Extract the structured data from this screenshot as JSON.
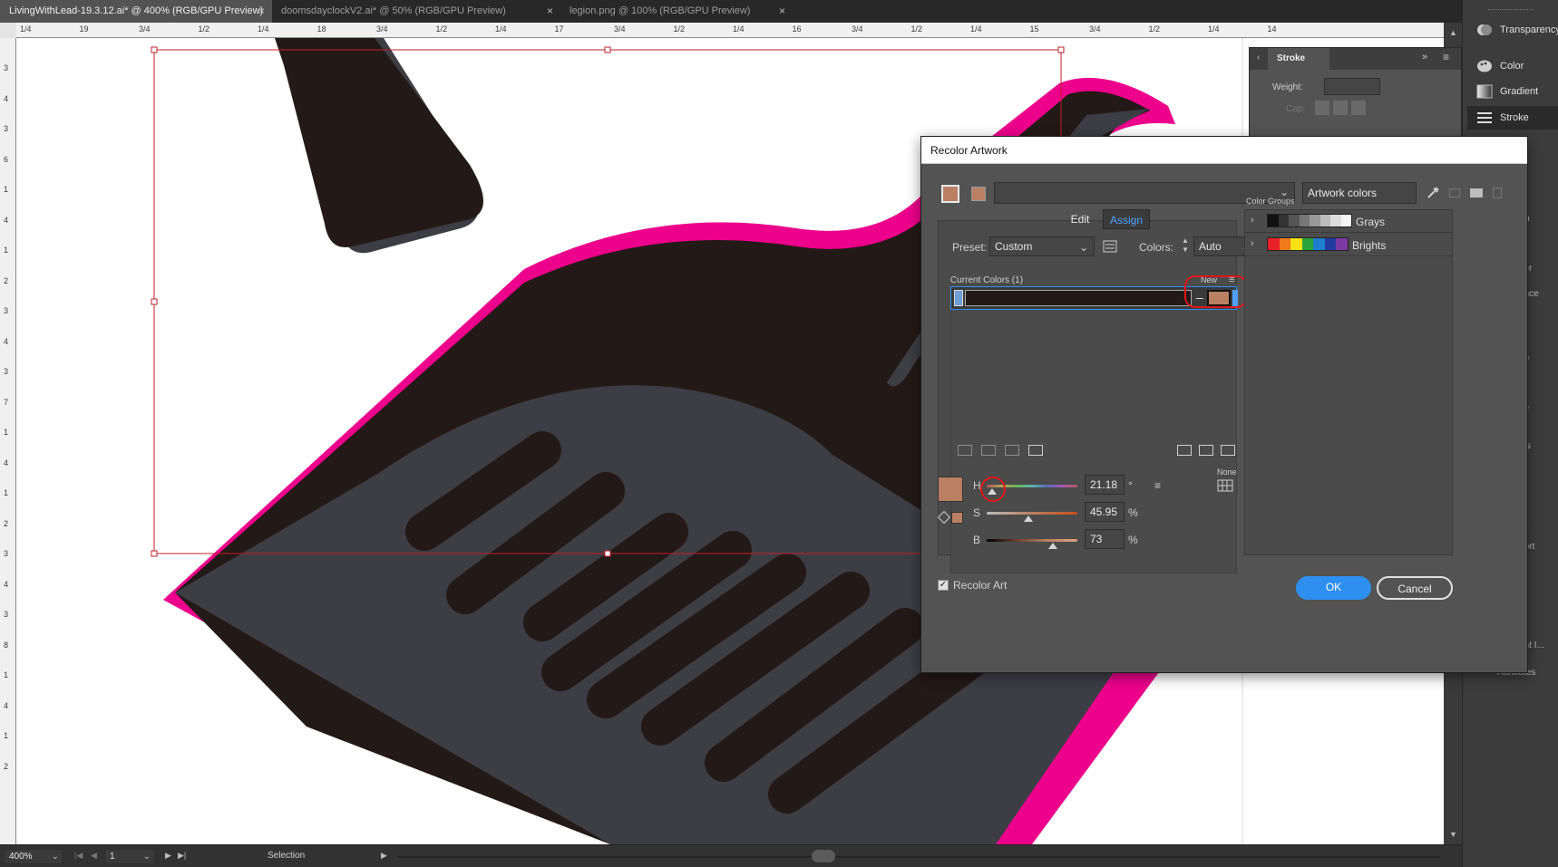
{
  "tabs": [
    {
      "label": "LivingWithLead-19.3.12.ai* @ 400% (RGB/GPU Preview)",
      "active": true
    },
    {
      "label": "doomsdayclockV2.ai* @ 50% (RGB/GPU Preview)",
      "active": false
    },
    {
      "label": "legion.png @ 100% (RGB/GPU Preview)",
      "active": false
    }
  ],
  "close_glyph": "×",
  "ruler": {
    "top_ticks": [
      "1/4",
      "19",
      "3/4",
      "1/2",
      "1/4",
      "18",
      "3/4",
      "1/2",
      "1/4",
      "17",
      "3/4",
      "1/2",
      "1/4",
      "16",
      "3/4",
      "1/2",
      "1/4",
      "15",
      "3/4",
      "1/2",
      "1/4",
      "14"
    ],
    "left_ticks": [
      "3",
      "4",
      "3",
      "6",
      "1",
      "4",
      "1",
      "2",
      "3",
      "4",
      "3",
      "7",
      "1",
      "4",
      "1",
      "2",
      "3",
      "4",
      "3",
      "8",
      "1",
      "4",
      "1",
      "2"
    ]
  },
  "dock": {
    "items": [
      {
        "label": "Transparency",
        "icon": "transparency-icon"
      },
      {
        "label": "Color",
        "icon": "palette-icon"
      },
      {
        "label": "Gradient",
        "icon": "gradient-icon"
      },
      {
        "label": "Stroke",
        "icon": "stroke-lines-icon"
      }
    ],
    "clipped_labels": [
      "es",
      "rm",
      "der",
      "ance",
      "er",
      "ph",
      "pe",
      "ies",
      "s",
      "ds",
      "port",
      "ent I...",
      "Attributes"
    ]
  },
  "stroke_panel": {
    "tab_label": "Stroke",
    "weight_label": "Weight:",
    "cap_label": "Cap:",
    "expand_glyph": "»",
    "menu_glyph": "≡"
  },
  "dialog": {
    "title": "Recolor Artwork",
    "artwork_colors_value": "Artwork colors",
    "tabs": {
      "edit": "Edit",
      "assign": "Assign"
    },
    "preset_label": "Preset:",
    "preset_value": "Custom",
    "colors_label": "Colors:",
    "colors_value": "Auto",
    "current_colors_label": "Current Colors (1)",
    "new_label": "New",
    "none_label": "None",
    "color_groups_label": "Color Groups",
    "groups": [
      {
        "name": "Grays",
        "swatches": [
          "#111111",
          "#333333",
          "#555555",
          "#777777",
          "#999999",
          "#bbbbbb",
          "#dddddd",
          "#f5f5f5"
        ]
      },
      {
        "name": "Brights",
        "swatches": [
          "#e8202a",
          "#f07a1a",
          "#f5e214",
          "#2aa33a",
          "#1e7fd0",
          "#253a9e",
          "#7b3aa3"
        ]
      }
    ],
    "hsb": {
      "h_label": "H",
      "h_value": "21.18",
      "h_unit": "°",
      "h_level": 0.06,
      "s_label": "S",
      "s_value": "45.95",
      "s_unit": "%",
      "s_level": 0.46,
      "b_label": "B",
      "b_value": "73",
      "b_unit": "%",
      "b_level": 0.73
    },
    "recolor_art_label": "Recolor Art",
    "recolor_art_checked": true,
    "ok_label": "OK",
    "cancel_label": "Cancel",
    "current_color_hex": "#231916",
    "new_color_hex": "#ba8064"
  },
  "status": {
    "zoom": "400%",
    "artboard": "1",
    "tool": "Selection"
  },
  "colors": {
    "magenta": "#ec008c",
    "dark_brown": "#231916",
    "slate": "#3d3d45",
    "accent_blue": "#2f8ff0"
  }
}
